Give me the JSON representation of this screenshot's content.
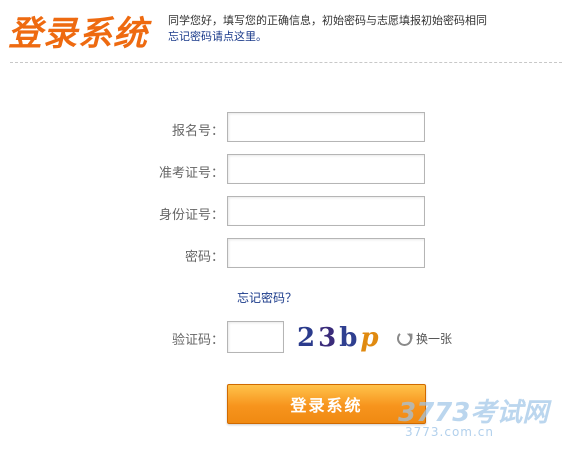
{
  "header": {
    "logo_text": "登录系统",
    "notice_line1": "同学您好，填写您的正确信息，初始密码与志愿填报初始密码相同",
    "notice_link": "忘记密码请点这里。"
  },
  "form": {
    "fields": [
      {
        "label": "报名号：",
        "value": ""
      },
      {
        "label": "准考证号：",
        "value": ""
      },
      {
        "label": "身份证号：",
        "value": ""
      },
      {
        "label": "密码：",
        "value": ""
      }
    ],
    "forgot_link": "忘记密码？",
    "captcha": {
      "label": "验证码：",
      "value": "",
      "chars": [
        "2",
        "3",
        "b",
        "p"
      ],
      "refresh_label": "换一张",
      "refresh_icon": "refresh-icon"
    },
    "submit_label": "登录系统"
  },
  "watermark": {
    "text": "3773考试网",
    "sub": "3773.com.cn"
  },
  "colors": {
    "accent": "#ee6a10",
    "link": "#1a3a8a",
    "button": "#f7941d"
  }
}
